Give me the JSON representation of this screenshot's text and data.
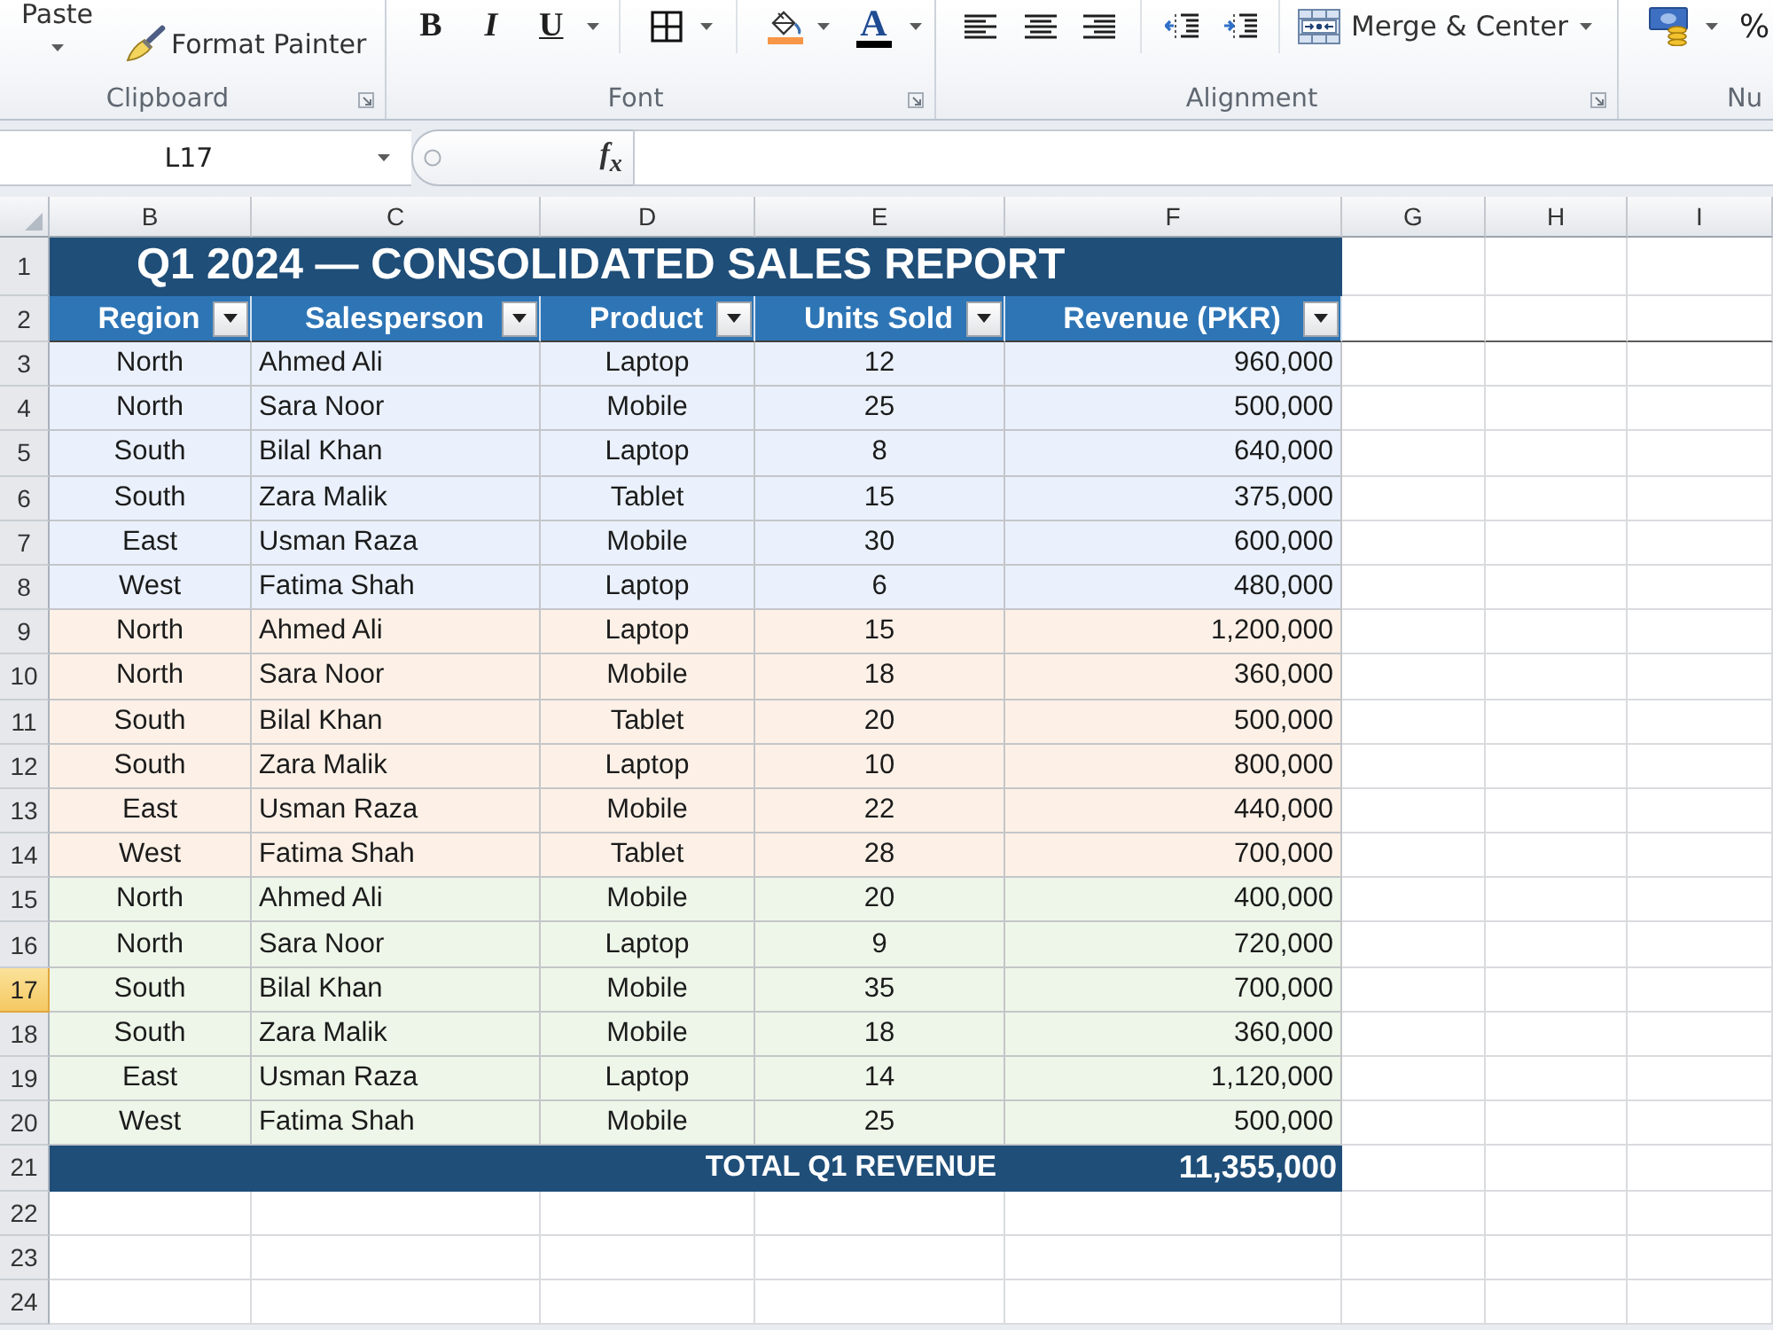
{
  "ribbon": {
    "groups": [
      {
        "label": "Clipboard",
        "dialog_launcher": true,
        "clusters": [
          [
            {
              "kind": "paste",
              "label": "Paste",
              "dropdown": true
            }
          ],
          [
            {
              "kind": "format_painter",
              "label": "Format Painter",
              "dropdown": false
            }
          ]
        ]
      },
      {
        "label": "Font",
        "dialog_launcher": true,
        "clusters": [
          [
            {
              "kind": "bold",
              "label": "B",
              "dropdown": false
            },
            {
              "kind": "italic",
              "label": "I",
              "dropdown": false
            },
            {
              "kind": "underline",
              "label": "U",
              "dropdown": true
            }
          ],
          [
            {
              "kind": "borders",
              "dropdown": true
            }
          ],
          [
            {
              "kind": "fill_color",
              "color": "#f79646",
              "dropdown": true
            },
            {
              "kind": "font_color",
              "label": "A",
              "color": "#000000",
              "dropdown": true
            }
          ]
        ]
      },
      {
        "label": "Alignment",
        "dialog_launcher": true,
        "clusters": [
          [
            {
              "kind": "align_left",
              "dropdown": false
            },
            {
              "kind": "align_center",
              "dropdown": false
            },
            {
              "kind": "align_right",
              "dropdown": false
            }
          ],
          [
            {
              "kind": "decrease_indent",
              "dropdown": false
            },
            {
              "kind": "increase_indent",
              "dropdown": false
            }
          ],
          [
            {
              "kind": "merge_center",
              "label": "Merge & Center",
              "dropdown": true
            }
          ]
        ]
      },
      {
        "label": "Nu",
        "dialog_launcher": false,
        "clusters": [
          [
            {
              "kind": "currency",
              "dropdown": true
            },
            {
              "kind": "percent",
              "label": "%",
              "dropdown": false
            }
          ]
        ]
      }
    ]
  },
  "formula_bar": {
    "name_box": "L17",
    "function_button": "f$_{x}$"
  },
  "sheet": {
    "columns": [
      {
        "label": "B",
        "selected": false
      },
      {
        "label": "C",
        "selected": false
      },
      {
        "label": "D",
        "selected": false
      },
      {
        "label": "E",
        "selected": false
      },
      {
        "label": "F",
        "selected": false
      },
      {
        "label": "G",
        "selected": false
      },
      {
        "label": "H",
        "selected": false
      },
      {
        "label": "I",
        "selected": false
      }
    ],
    "rows": [
      {
        "label": "1",
        "selected": false
      },
      {
        "label": "2",
        "selected": false
      },
      {
        "label": "3",
        "selected": false
      },
      {
        "label": "4",
        "selected": false
      },
      {
        "label": "5",
        "selected": false
      },
      {
        "label": "6",
        "selected": false
      },
      {
        "label": "7",
        "selected": false
      },
      {
        "label": "8",
        "selected": false
      },
      {
        "label": "9",
        "selected": false
      },
      {
        "label": "10",
        "selected": false
      },
      {
        "label": "11",
        "selected": false
      },
      {
        "label": "12",
        "selected": false
      },
      {
        "label": "13",
        "selected": false
      },
      {
        "label": "14",
        "selected": false
      },
      {
        "label": "15",
        "selected": false
      },
      {
        "label": "16",
        "selected": false
      },
      {
        "label": "17",
        "selected": true
      },
      {
        "label": "18",
        "selected": false
      },
      {
        "label": "19",
        "selected": false
      },
      {
        "label": "20",
        "selected": false
      },
      {
        "label": "21",
        "selected": false
      },
      {
        "label": "22",
        "selected": false
      },
      {
        "label": "23",
        "selected": false
      },
      {
        "label": "24",
        "selected": false
      }
    ]
  },
  "table": {
    "title": "Q1 2024 — CONSOLIDATED SALES REPORT",
    "columns": [
      {
        "label": "Region",
        "filter": true
      },
      {
        "label": "Salesperson",
        "filter": true
      },
      {
        "label": "Product",
        "filter": true
      },
      {
        "label": "Units Sold",
        "filter": true
      },
      {
        "label": "Revenue (PKR)",
        "filter": true
      }
    ],
    "rows": [
      {
        "color": "#eaf1fc",
        "cells": [
          "North",
          "Ahmed Ali",
          "Laptop",
          "12",
          "960,000"
        ]
      },
      {
        "color": "#eaf1fc",
        "cells": [
          "North",
          "Sara Noor",
          "Mobile",
          "25",
          "500,000"
        ]
      },
      {
        "color": "#eaf1fc",
        "cells": [
          "South",
          "Bilal Khan",
          "Laptop",
          "8",
          "640,000"
        ]
      },
      {
        "color": "#eaf1fc",
        "cells": [
          "South",
          "Zara Malik",
          "Tablet",
          "15",
          "375,000"
        ]
      },
      {
        "color": "#eaf1fc",
        "cells": [
          "East",
          "Usman Raza",
          "Mobile",
          "30",
          "600,000"
        ]
      },
      {
        "color": "#eaf1fc",
        "cells": [
          "West",
          "Fatima Shah",
          "Laptop",
          "6",
          "480,000"
        ]
      },
      {
        "color": "#fdf1e7",
        "cells": [
          "North",
          "Ahmed Ali",
          "Laptop",
          "15",
          "1,200,000"
        ]
      },
      {
        "color": "#fdf1e7",
        "cells": [
          "North",
          "Sara Noor",
          "Mobile",
          "18",
          "360,000"
        ]
      },
      {
        "color": "#fdf1e7",
        "cells": [
          "South",
          "Bilal Khan",
          "Tablet",
          "20",
          "500,000"
        ]
      },
      {
        "color": "#fdf1e7",
        "cells": [
          "South",
          "Zara Malik",
          "Laptop",
          "10",
          "800,000"
        ]
      },
      {
        "color": "#fdf1e7",
        "cells": [
          "East",
          "Usman Raza",
          "Mobile",
          "22",
          "440,000"
        ]
      },
      {
        "color": "#fdf1e7",
        "cells": [
          "West",
          "Fatima Shah",
          "Tablet",
          "28",
          "700,000"
        ]
      },
      {
        "color": "#eef6e9",
        "cells": [
          "North",
          "Ahmed Ali",
          "Mobile",
          "20",
          "400,000"
        ]
      },
      {
        "color": "#eef6e9",
        "cells": [
          "North",
          "Sara Noor",
          "Laptop",
          "9",
          "720,000"
        ]
      },
      {
        "color": "#eef6e9",
        "cells": [
          "South",
          "Bilal Khan",
          "Mobile",
          "35",
          "700,000"
        ]
      },
      {
        "color": "#eef6e9",
        "cells": [
          "South",
          "Zara Malik",
          "Mobile",
          "18",
          "360,000"
        ]
      },
      {
        "color": "#eef6e9",
        "cells": [
          "East",
          "Usman Raza",
          "Laptop",
          "14",
          "1,120,000"
        ]
      },
      {
        "color": "#eef6e9",
        "cells": [
          "West",
          "Fatima Shah",
          "Mobile",
          "25",
          "500,000"
        ]
      }
    ],
    "total": {
      "label": "TOTAL Q1 REVENUE",
      "value": "11,355,000"
    }
  }
}
